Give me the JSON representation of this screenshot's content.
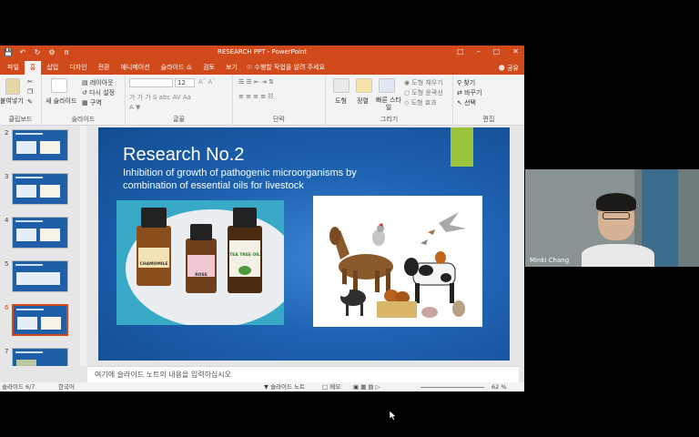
{
  "window": {
    "title": "RESEARCH PPT - PowerPoint"
  },
  "tabs": [
    {
      "label": "파일",
      "active": false
    },
    {
      "label": "홈",
      "active": true
    },
    {
      "label": "삽입",
      "active": false
    },
    {
      "label": "디자인",
      "active": false
    },
    {
      "label": "전환",
      "active": false
    },
    {
      "label": "애니메이션",
      "active": false
    },
    {
      "label": "슬라이드 쇼",
      "active": false
    },
    {
      "label": "검토",
      "active": false
    },
    {
      "label": "보기",
      "active": false
    }
  ],
  "tell_me": "수행할 작업을 알려 주세요",
  "share_label": "공유",
  "ribbon": {
    "clipboard": {
      "paste": "붙여넣기",
      "label": "클립보드"
    },
    "slides": {
      "new_slide": "새 슬라이드",
      "layout": "레이아웃",
      "reset": "다시 설정",
      "section": "구역",
      "label": "슬라이드"
    },
    "font": {
      "size": "12",
      "label": "글꼴"
    },
    "paragraph": {
      "label": "단락"
    },
    "drawing": {
      "shapes": "도형",
      "arrange": "정렬",
      "quick_styles": "빠른 스타일",
      "fill": "도형 채우기",
      "outline": "도형 윤곽선",
      "effects": "도형 효과",
      "label": "그리기"
    },
    "editing": {
      "find": "찾기",
      "replace": "바꾸기",
      "select": "선택",
      "label": "편집"
    }
  },
  "thumbnails": [
    {
      "num": "2",
      "selected": false
    },
    {
      "num": "3",
      "selected": false
    },
    {
      "num": "4",
      "selected": false
    },
    {
      "num": "5",
      "selected": false
    },
    {
      "num": "6",
      "selected": true
    },
    {
      "num": "7",
      "selected": false
    }
  ],
  "slide": {
    "title": "Research No.2",
    "subtitle": "Inhibition of growth of pathogenic microorganisms by combination of essential oils for livestock",
    "bottle_labels": [
      "CHAMOMILE",
      "ROSE",
      "TEA TREE OIL"
    ]
  },
  "notes_placeholder": "여기에 슬라이드 노트의 내용을 입력하십시오",
  "status": {
    "slide_count": "슬라이드 6/7",
    "language": "한국어",
    "notes": "슬라이드 노트",
    "comments": "메모",
    "zoom": "62 %"
  },
  "video": {
    "participant": "Minki Chang"
  },
  "colors": {
    "ppt_accent": "#d04a1c",
    "slide_blue": "#1e63b2",
    "accent_green": "#9bc53d"
  }
}
